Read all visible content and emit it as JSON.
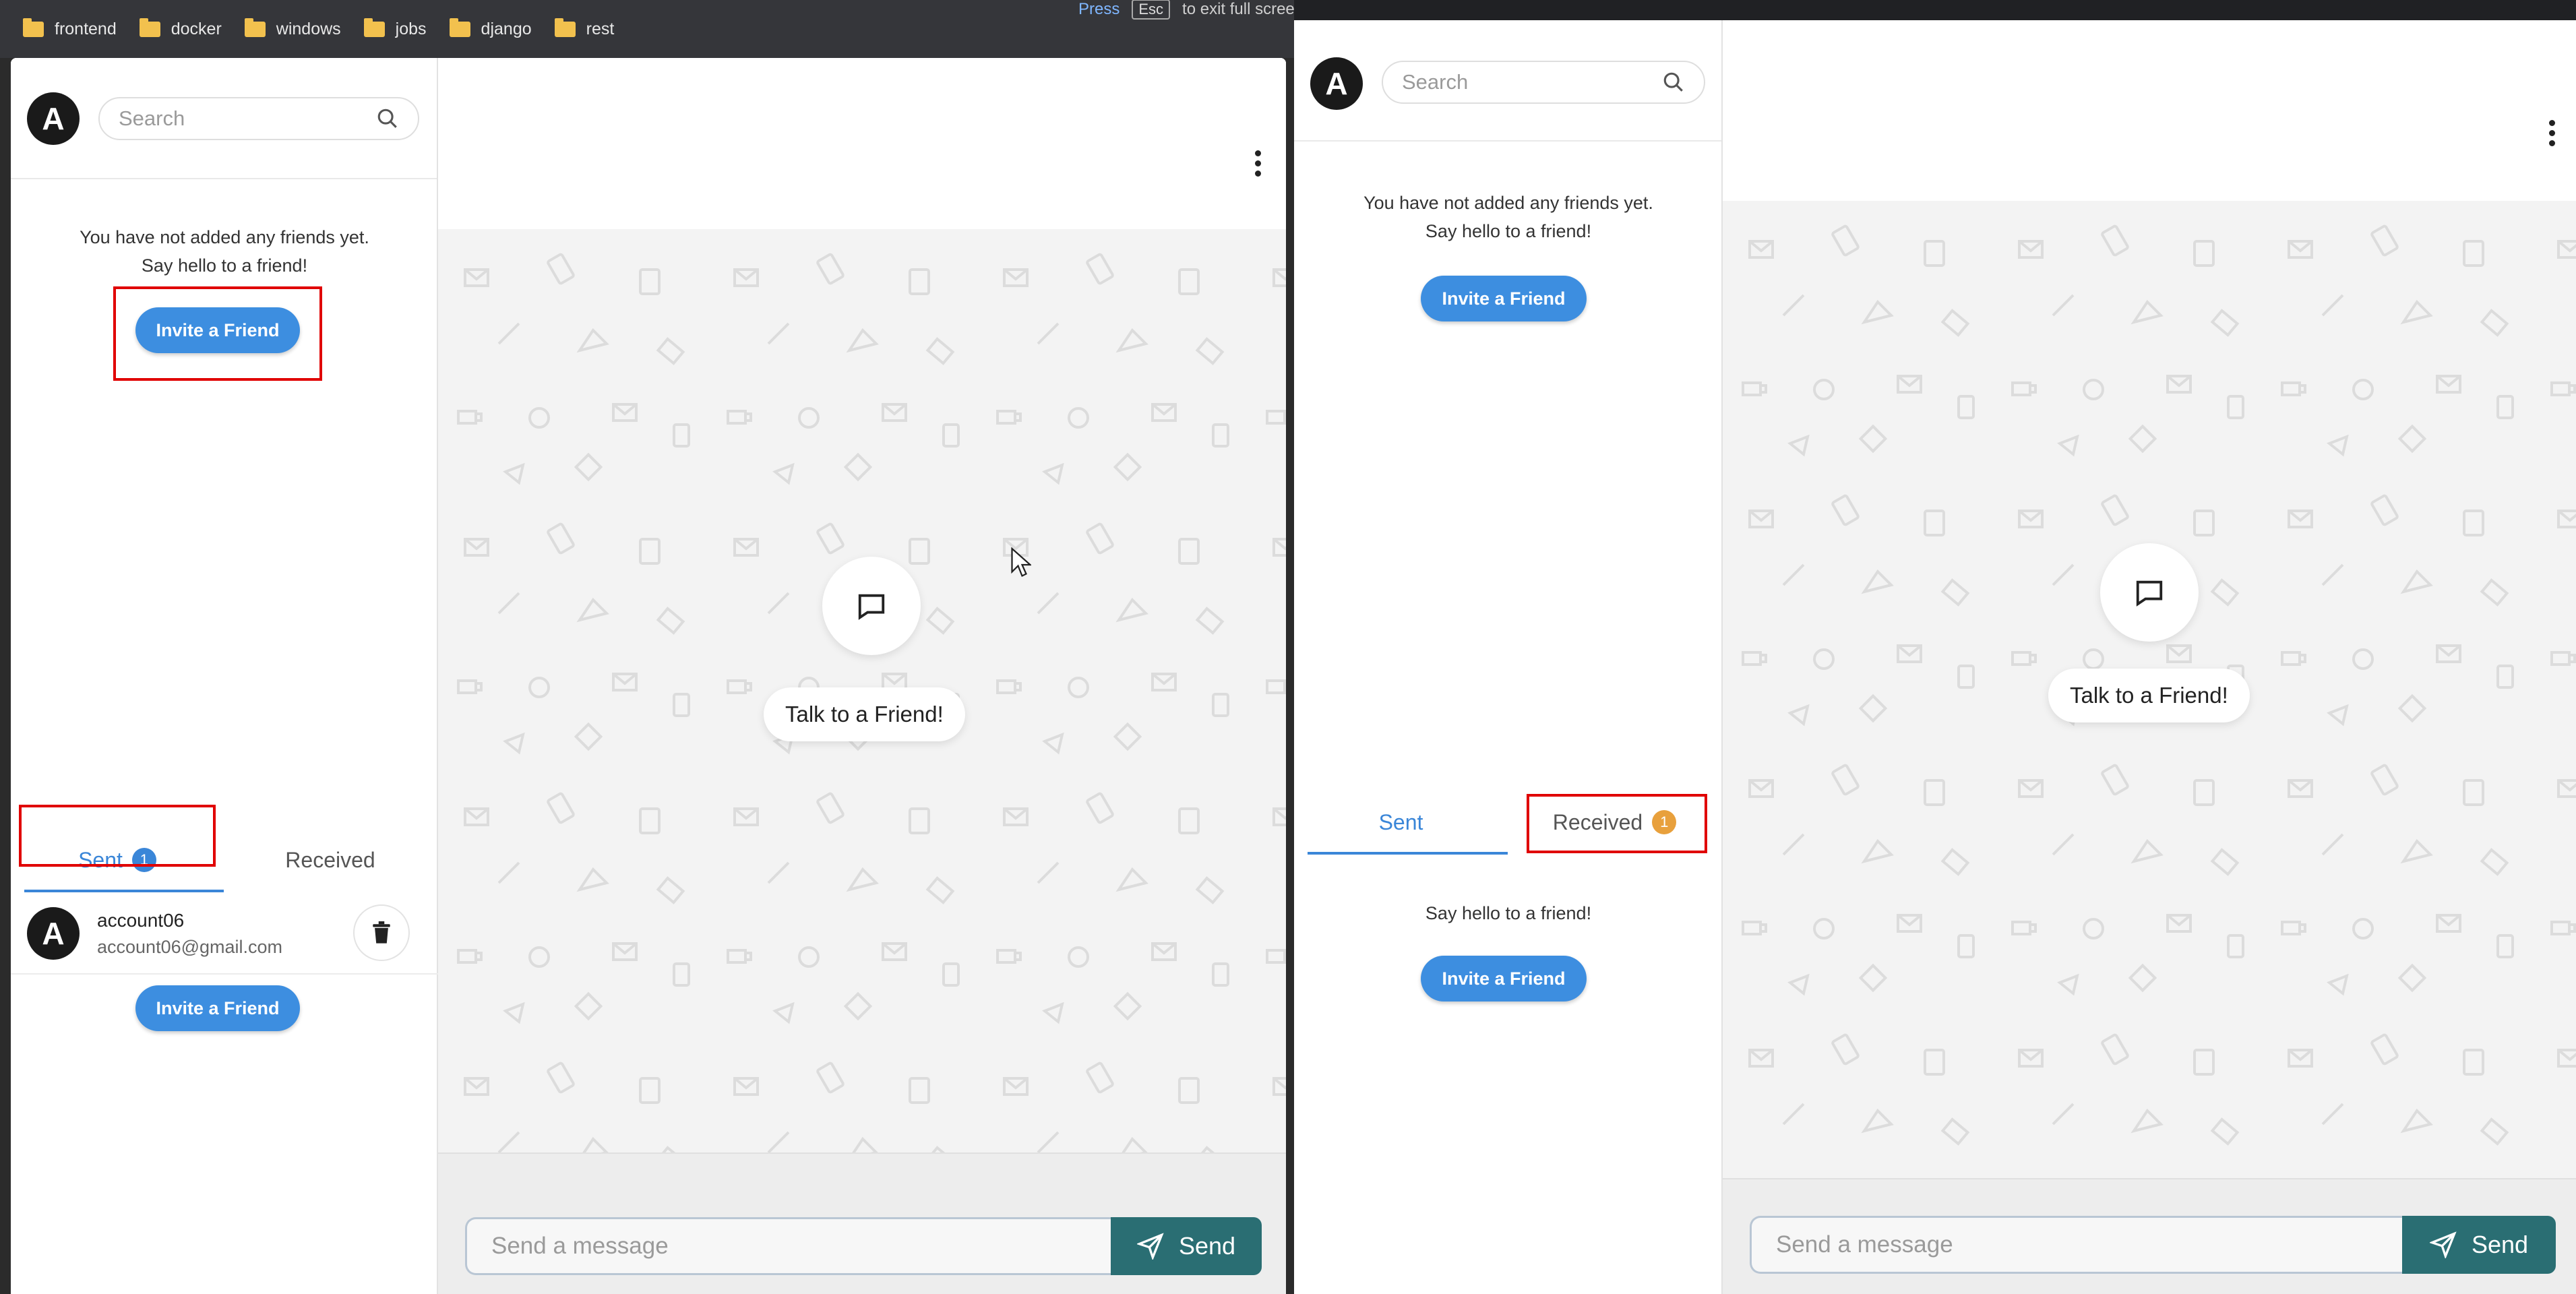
{
  "bookmarks": [
    "frontend",
    "docker",
    "windows",
    "jobs",
    "django",
    "rest"
  ],
  "fullscreen_hint": {
    "press": "Press",
    "key": "Esc",
    "rest": "to exit full screen"
  },
  "left_app": {
    "avatar_letter": "A",
    "search_placeholder": "Search",
    "empty_line1": "You have not added any friends yet.",
    "empty_line2": "Say hello to a friend!",
    "invite_label": "Invite a Friend",
    "tabs": {
      "sent": "Sent",
      "sent_count": "1",
      "received": "Received"
    },
    "friend": {
      "avatar_letter": "A",
      "name": "account06",
      "email": "account06@gmail.com"
    },
    "invite_label_2": "Invite a Friend",
    "talk_label": "Talk to a Friend!",
    "message_placeholder": "Send a message",
    "send_label": "Send"
  },
  "right_app": {
    "avatar_letter": "A",
    "search_placeholder": "Search",
    "empty_line1": "You have not added any friends yet.",
    "empty_line2": "Say hello to a friend!",
    "invite_label": "Invite a Friend",
    "tabs": {
      "sent": "Sent",
      "received": "Received",
      "received_count": "1"
    },
    "hello_line": "Say hello to a friend!",
    "invite_label_2": "Invite a Friend",
    "talk_label": "Talk to a Friend!",
    "message_placeholder": "Send a message",
    "send_label": "Send"
  },
  "colors": {
    "primary": "#3d8ee0",
    "send": "#2a6e73",
    "highlight": "#e00000",
    "badge_orange": "#e8a03c"
  }
}
